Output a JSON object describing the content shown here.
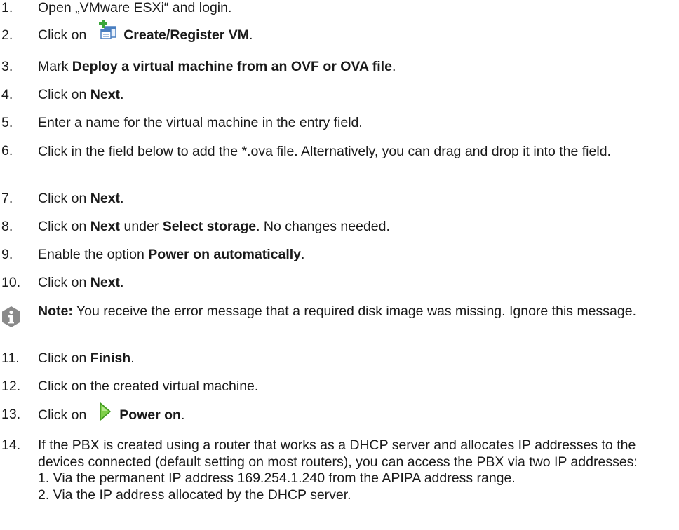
{
  "steps": [
    {
      "num": "1.",
      "parts": [
        {
          "t": "Open „VMware ESXi“ and login."
        }
      ]
    },
    {
      "num": "2.",
      "parts": [
        {
          "t": "Click on "
        },
        {
          "icon": "create-register-vm-icon"
        },
        {
          "t": " "
        },
        {
          "b": "Create/Register VM"
        },
        {
          "t": "."
        }
      ]
    },
    {
      "num": "3.",
      "parts": [
        {
          "t": "Mark "
        },
        {
          "b": "Deploy a virtual machine from an OVF or OVA file"
        },
        {
          "t": "."
        }
      ]
    },
    {
      "num": "4.",
      "parts": [
        {
          "t": "Click on "
        },
        {
          "b": "Next"
        },
        {
          "t": "."
        }
      ]
    },
    {
      "num": "5.",
      "parts": [
        {
          "t": "Enter a name for the virtual machine in the entry field."
        }
      ]
    },
    {
      "num": "6.",
      "parts": [
        {
          "t": "Click in the field below to add the *.ova file. Alternatively, you can drag and drop it into the field."
        }
      ]
    },
    {
      "num": "7.",
      "parts": [
        {
          "t": "Click on "
        },
        {
          "b": "Next"
        },
        {
          "t": "."
        }
      ]
    },
    {
      "num": "8.",
      "parts": [
        {
          "t": "Click on "
        },
        {
          "b": "Next"
        },
        {
          "t": " under "
        },
        {
          "b": "Select storage"
        },
        {
          "t": ". No changes needed."
        }
      ]
    },
    {
      "num": "9.",
      "parts": [
        {
          "t": "Enable the option "
        },
        {
          "b": "Power on automatically"
        },
        {
          "t": "."
        }
      ]
    },
    {
      "num": "10.",
      "parts": [
        {
          "t": "Click on "
        },
        {
          "b": "Next"
        },
        {
          "t": "."
        }
      ]
    },
    {
      "num": "11.",
      "parts": [
        {
          "t": "Click on "
        },
        {
          "b": "Finish"
        },
        {
          "t": "."
        }
      ]
    },
    {
      "num": "12.",
      "parts": [
        {
          "t": "Click on the created virtual machine."
        }
      ]
    },
    {
      "num": "13.",
      "parts": [
        {
          "t": "Click on "
        },
        {
          "icon": "power-on-icon"
        },
        {
          "t": " "
        },
        {
          "b": "Power on"
        },
        {
          "t": "."
        }
      ]
    },
    {
      "num": "14.",
      "parts": [
        {
          "t": "If the PBX is created using a router that works as a DHCP server and allocates IP addresses to the devices connected (default setting on most routers), you can access the PBX via two IP addresses:"
        }
      ],
      "sub": [
        "1. Via the permanent IP address 169.254.1.240 from the APIPA address range.",
        "2. Via the IP address allocated by the DHCP server."
      ]
    }
  ],
  "note": {
    "label": "Note:",
    "text": " You receive the error message that a required disk image was missing. Ignore this message.",
    "icon": "info-icon"
  },
  "colors": {
    "text": "#1a1a1a",
    "info_icon": "#8a8a8a",
    "power_green": "#5cb82e"
  }
}
